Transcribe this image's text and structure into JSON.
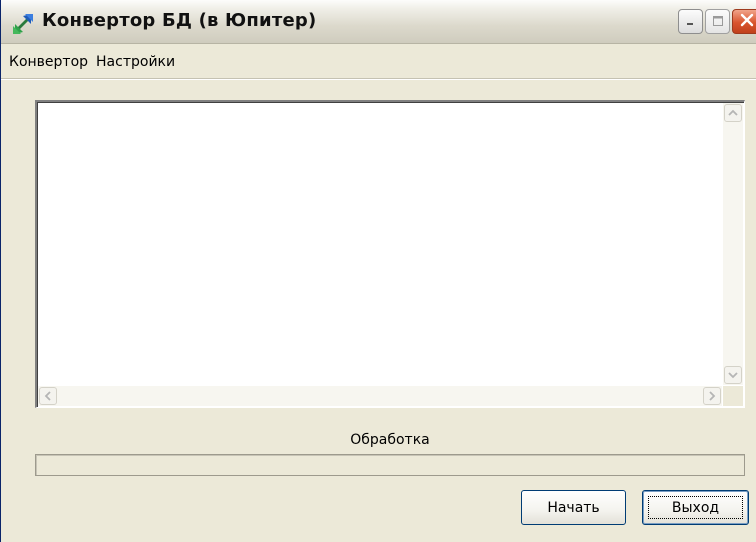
{
  "window": {
    "title": "Конвертор БД (в Юпитер)",
    "app_icon": "arrow-icon",
    "controls": {
      "minimize_icon": "minimize-icon",
      "maximize_icon": "maximize-icon",
      "close_icon": "close-icon"
    }
  },
  "menu": {
    "items": [
      {
        "label": "Конвертор"
      },
      {
        "label": "Настройки"
      }
    ]
  },
  "log": {
    "text": "",
    "scroll_icons": {
      "up": "scroll-up-icon",
      "down": "scroll-down-icon",
      "left": "scroll-left-icon",
      "right": "scroll-right-icon"
    }
  },
  "progress": {
    "label": "Обработка",
    "value_percent": 0
  },
  "buttons": {
    "start_label": "Начать",
    "exit_label": "Выход"
  },
  "colors": {
    "window_bg": "#ece9d8",
    "close_button": "#d9552e",
    "button_border": "#003c74"
  }
}
